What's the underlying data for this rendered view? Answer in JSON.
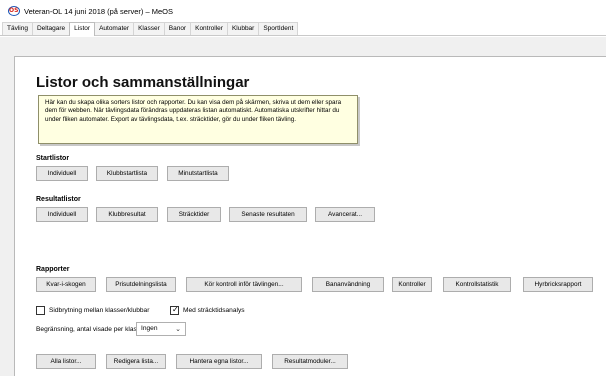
{
  "window": {
    "title": "Veteran-OL 14 juni 2018 (på server) – MeOS",
    "logo_text": "OS"
  },
  "tabs": [
    {
      "label": "Tävling",
      "active": false
    },
    {
      "label": "Deltagare",
      "active": false
    },
    {
      "label": "Listor",
      "active": true
    },
    {
      "label": "Automater",
      "active": false
    },
    {
      "label": "Klasser",
      "active": false
    },
    {
      "label": "Banor",
      "active": false
    },
    {
      "label": "Kontroller",
      "active": false
    },
    {
      "label": "Klubbar",
      "active": false
    },
    {
      "label": "SportIdent",
      "active": false
    }
  ],
  "main": {
    "title": "Listor och sammanställningar",
    "info": "Här kan du skapa olika sorters listor och rapporter. Du kan visa dem på skärmen, skriva ut dem eller spara dem för webben. När tävlingsdata förändras uppdateras listan automatiskt. Automatiska utskrifter hittar du under fliken automater. Export av tävlingsdata, t.ex. sträcktider, gör du under fliken tävling."
  },
  "startlists": {
    "label": "Startlistor",
    "buttons": [
      "Individuell",
      "Klubbstartlista",
      "Minutstartlista"
    ]
  },
  "resultlists": {
    "label": "Resultatlistor",
    "buttons": [
      "Individuell",
      "Klubbresultat",
      "Sträcktider",
      "Senaste resultaten",
      "Avancerat..."
    ]
  },
  "reports": {
    "label": "Rapporter",
    "buttons": [
      "Kvar-i-skogen",
      "Prisutdelningslista",
      "Kör kontroll inför tävlingen...",
      "Bananvändning",
      "Kontroller",
      "Kontrollstatistik",
      "Hyrbricksrapport"
    ]
  },
  "options": {
    "page_break_label": "Sidbrytning mellan klasser/klubbar",
    "page_break_checked": false,
    "split_analysis_label": "Med sträcktidsanalys",
    "split_analysis_checked": true,
    "limit_label": "Begränsning, antal visade per klass:",
    "limit_value": "Ingen"
  },
  "bottom_buttons": [
    "Alla listor...",
    "Redigera lista...",
    "Hantera egna listor...",
    "Resultatmoduler..."
  ],
  "colors": {
    "info_bg": "#ffffe1",
    "logo_red": "#d9271c",
    "logo_blue": "#1a56b8"
  }
}
